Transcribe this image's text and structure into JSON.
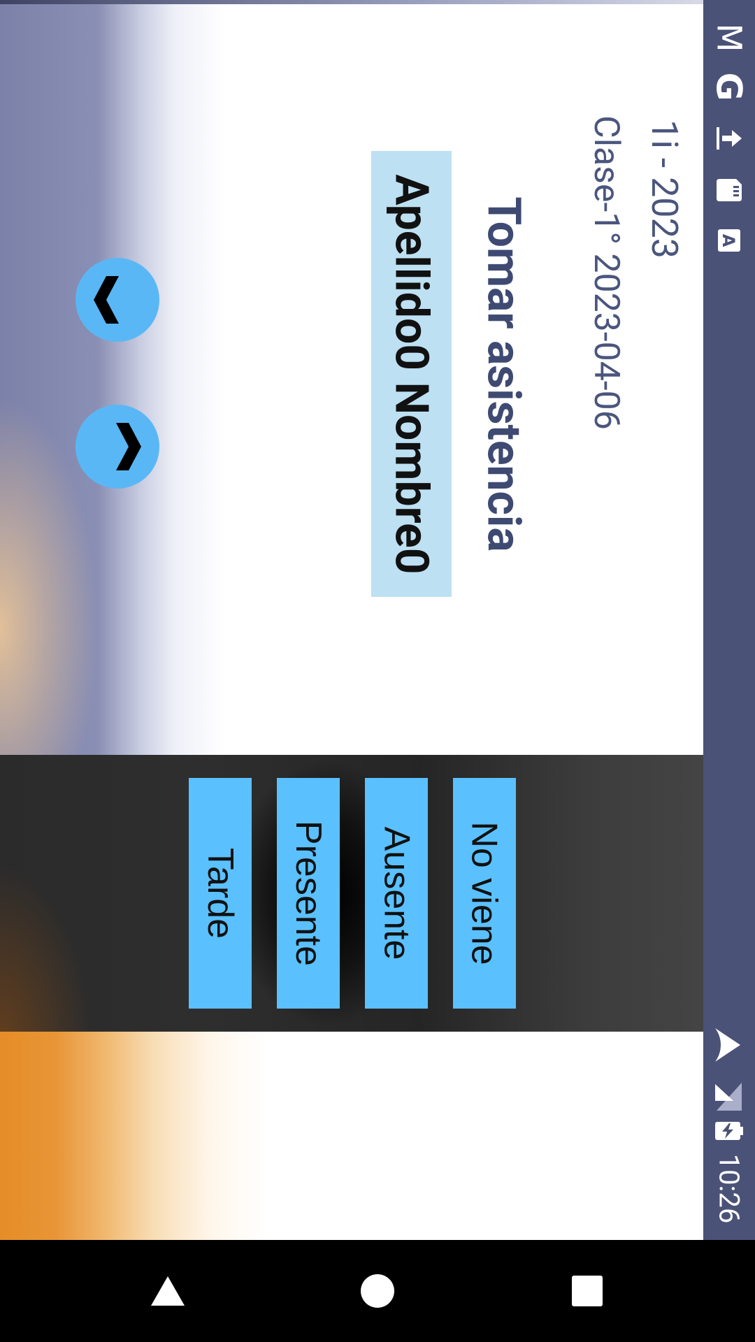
{
  "app": {
    "course": "1i - 2023",
    "class_info": "Clase-1° 2023-04-06",
    "title": "Tomar asistencia",
    "student_name": "Apellido0 Nombre0"
  },
  "navigation": {
    "up_icon": "chevron-up-icon",
    "down_icon": "chevron-down-icon"
  },
  "actions": {
    "no_viene": "No viene",
    "ausente": "Ausente",
    "presente": "Presente",
    "tarde": "Tarde"
  },
  "status_bar": {
    "time": "10:26",
    "icons": [
      "gmail-icon",
      "google-icon",
      "upload-icon",
      "sd-card-icon",
      "font-icon",
      "wifi-icon",
      "signal-icon",
      "battery-charging-icon"
    ]
  },
  "system_nav": {
    "back": "back-triangle-icon",
    "home": "home-circle-icon",
    "recents": "recents-square-icon"
  },
  "colors": {
    "accent": "#5ac1fe",
    "title": "#3e4a72",
    "status_bar": "#4b5278",
    "student_highlight": "#bde0f3"
  }
}
